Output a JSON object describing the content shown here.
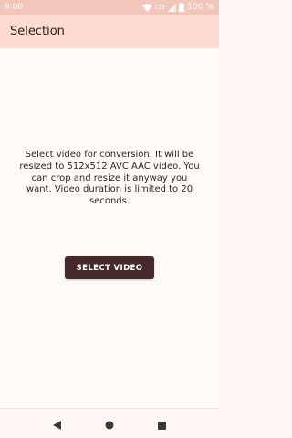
{
  "status_bar": {
    "time": "9:00",
    "network": "LTE",
    "battery": "100 %",
    "icons": [
      "wifi-icon",
      "signal-icon",
      "battery-icon"
    ]
  },
  "app_bar": {
    "title": "Selection"
  },
  "main": {
    "message": "Select video for conversion. It will be resized to 512x512 AVC AAC video. You can crop and resize it anyway you want. Video duration is limited to 20 seconds.",
    "button_label": "SELECT VIDEO"
  },
  "nav_bar": {
    "icons": [
      "back-icon",
      "home-icon",
      "recents-icon"
    ]
  },
  "colors": {
    "status_bar": "#f3c6bc",
    "app_bar": "#fedbd1",
    "background": "#fffaf8",
    "button": "#442a28"
  }
}
